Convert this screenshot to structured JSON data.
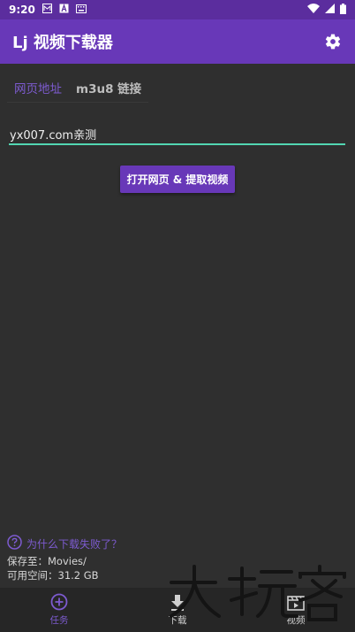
{
  "status_bar": {
    "time": "9:20",
    "icons": [
      "m-icon",
      "a-icon",
      "keyboard-icon"
    ],
    "right_icons": [
      "wifi-icon",
      "signal-icon",
      "battery-icon"
    ]
  },
  "app_bar": {
    "title": "Lj 视频下载器",
    "settings_icon": "gear-icon",
    "color": "#6838b8"
  },
  "tabs": [
    {
      "label": "网页地址",
      "active": true
    },
    {
      "label": "m3u8 链接",
      "active": false
    }
  ],
  "url_input": {
    "value": "yx007.com亲测",
    "underline_color": "#52d6b2"
  },
  "open_button": {
    "label": "打开网页 & 提取视频"
  },
  "help": {
    "icon": "question-circle-icon",
    "label": "为什么下载失败了？"
  },
  "storage": {
    "save_path": "保存至：Movies/",
    "free_space": "可用空间：31.2 GB"
  },
  "bottom_nav": [
    {
      "label": "任务",
      "icon": "add-circle-icon",
      "active": true
    },
    {
      "label": "下载",
      "icon": "download-icon",
      "active": false
    },
    {
      "label": "视频",
      "icon": "video-icon",
      "active": false
    }
  ],
  "accent_color": "#7d5bd0"
}
